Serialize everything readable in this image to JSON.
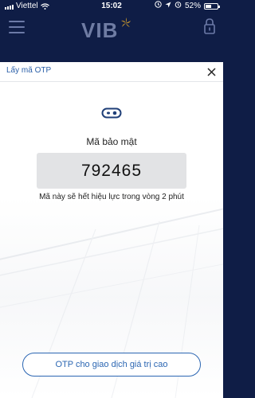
{
  "status_bar": {
    "carrier": "Viettel",
    "time": "15:02",
    "battery_text": "52%",
    "battery_level": 0.52
  },
  "header": {
    "logo_text": "VIB"
  },
  "modal": {
    "title": "Lấy mã OTP",
    "label": "Mã bảo mật",
    "otp_code": "792465",
    "expiry_note": "Mã này sẽ hết hiệu lực trong vòng 2 phút",
    "high_value_button": "OTP cho giao dịch giá trị cao"
  },
  "colors": {
    "brand_navy": "#0f1d46",
    "accent_blue": "#2b66b2",
    "otp_box_bg": "#e2e3e5"
  },
  "icons": [
    "signal-icon",
    "wifi-icon",
    "location-icon",
    "alarm-icon",
    "battery-icon",
    "menu-icon",
    "vib-star-icon",
    "lock-icon",
    "close-icon",
    "otp-key-icon"
  ]
}
